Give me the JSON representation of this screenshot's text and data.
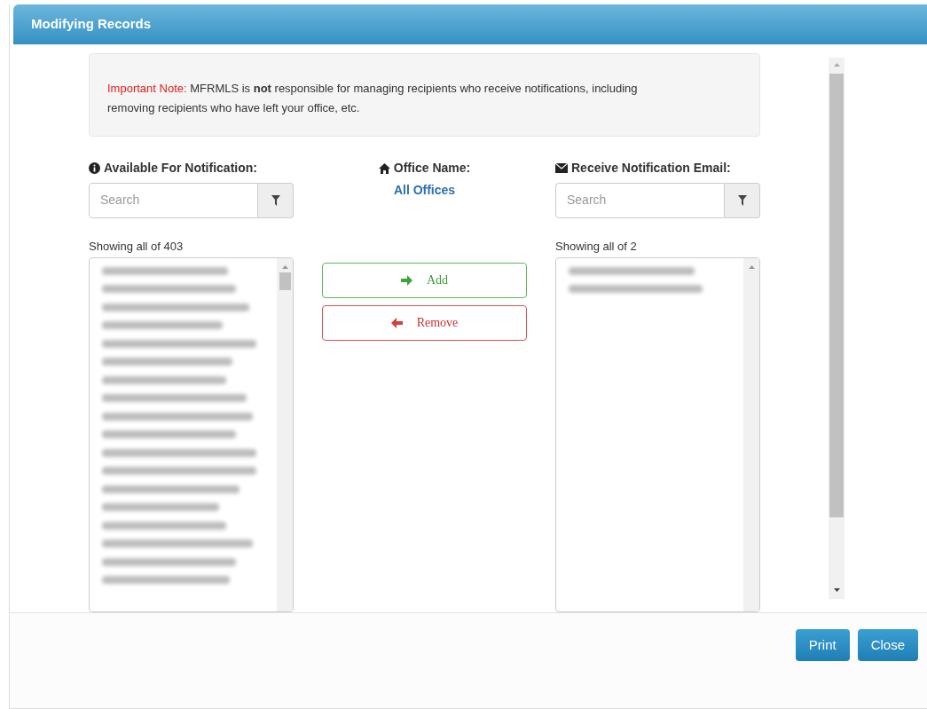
{
  "window": {
    "title": "Modifying Records"
  },
  "note": {
    "label": "Important Note:",
    "text": "MFRMLS is **not** responsible for managing recipients who receive notifications, including removing recipients who have left your office, etc."
  },
  "available": {
    "heading": "Available For Notification:",
    "search": {
      "placeholder": "Search"
    },
    "count": "Showing all of 403",
    "entries": [
      {
        "kind": "blurred"
      },
      {
        "kind": "blurred"
      },
      {
        "kind": "blurred"
      },
      {
        "kind": "blurred"
      },
      {
        "kind": "blurred"
      },
      {
        "kind": "blurred"
      },
      {
        "kind": "blurred"
      },
      {
        "kind": "blurred"
      },
      {
        "kind": "blurred"
      },
      {
        "kind": "blurred"
      },
      {
        "kind": "blurred"
      },
      {
        "kind": "blurred"
      },
      {
        "kind": "blurred"
      },
      {
        "kind": "blurred"
      },
      {
        "kind": "blurred"
      },
      {
        "kind": "blurred"
      },
      {
        "kind": "blurred"
      },
      {
        "kind": "blurred"
      }
    ]
  },
  "office": {
    "heading": "Office Name:",
    "value": "All Offices"
  },
  "actions": [
    {
      "kind": "add",
      "label": "Add"
    },
    {
      "kind": "remove",
      "label": "Remove"
    }
  ],
  "receiving": {
    "heading": "Receive Notification Email:",
    "search": {
      "placeholder": "Search"
    },
    "count": "Showing all of 2",
    "entries": [
      {
        "kind": "blurred"
      },
      {
        "kind": "blurred"
      }
    ]
  },
  "buttons": [
    "Print",
    "Close"
  ]
}
